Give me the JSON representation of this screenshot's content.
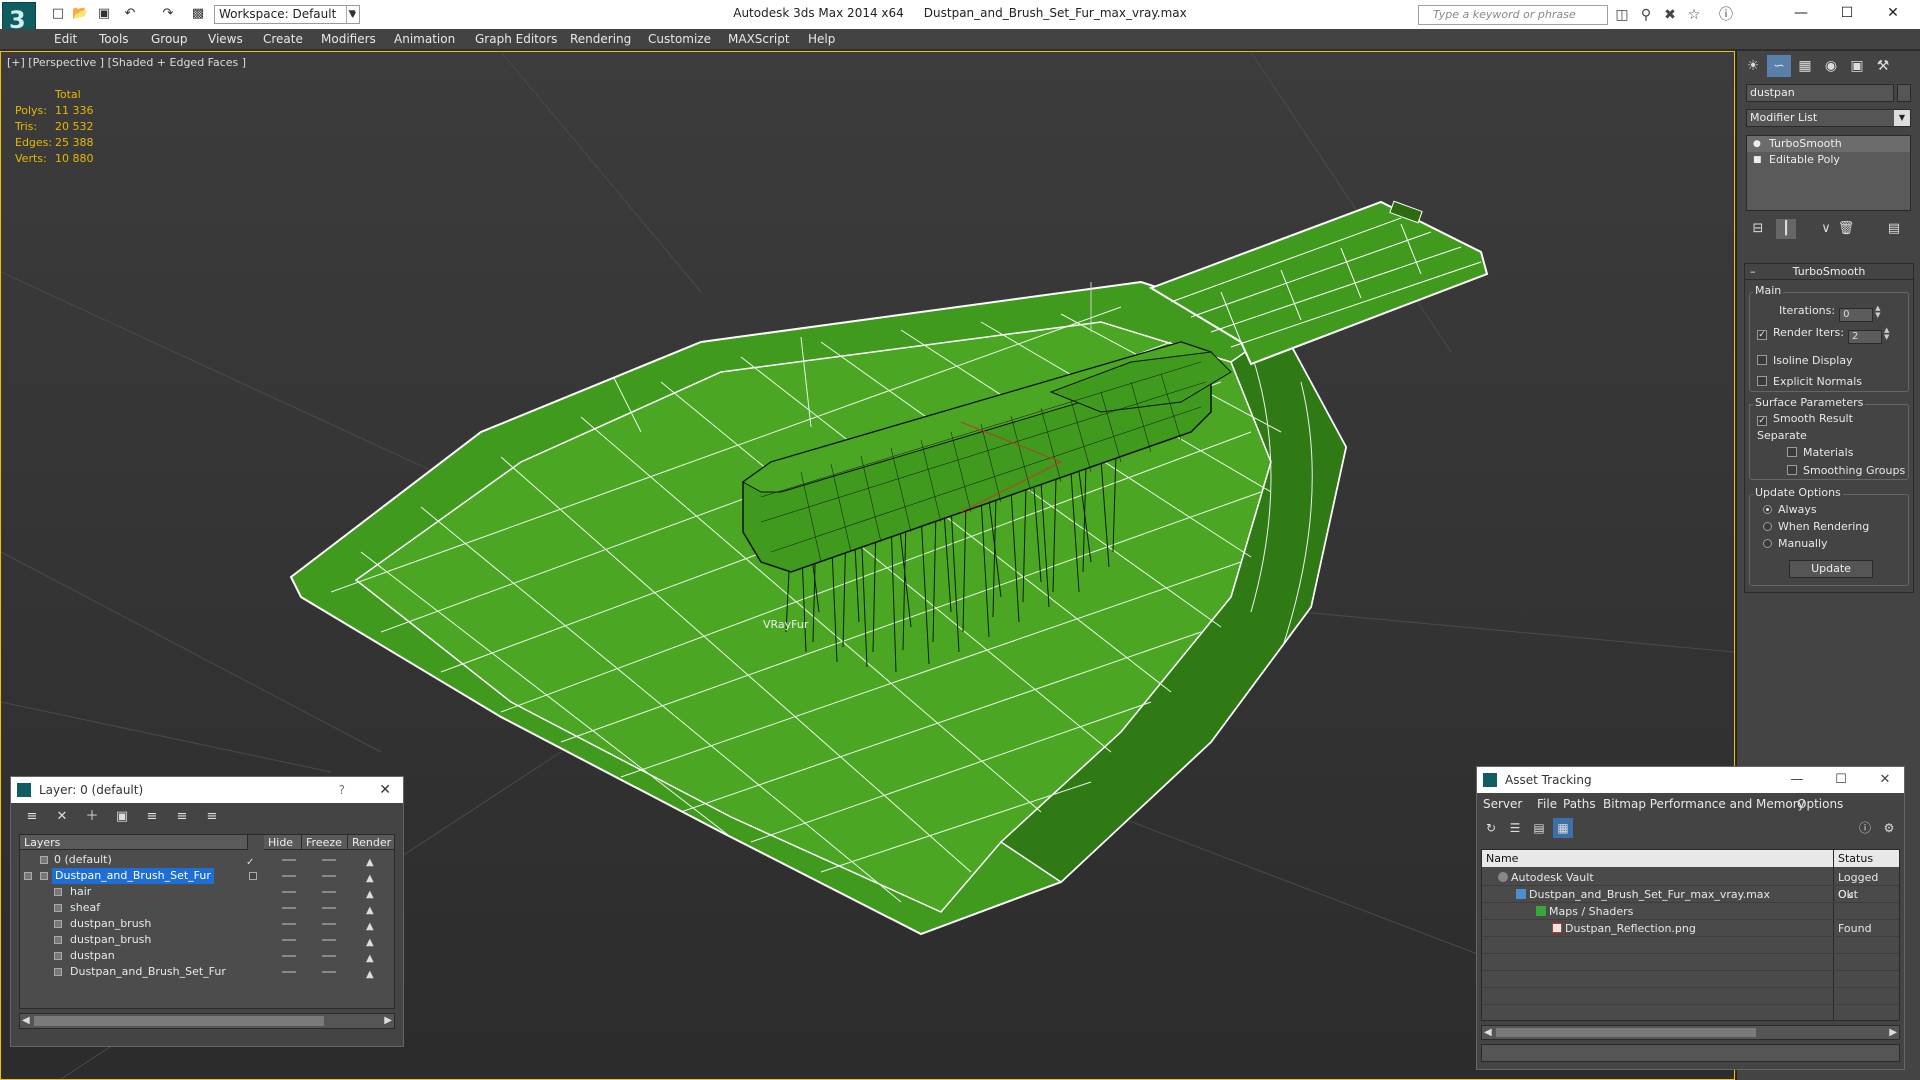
{
  "titlebar": {
    "app_title": "Autodesk 3ds Max 2014 x64",
    "file_title": "Dustpan_and_Brush_Set_Fur_max_vray.max",
    "workspace": "Workspace: Default",
    "search_placeholder": "Type a keyword or phrase"
  },
  "menu": [
    "Edit",
    "Tools",
    "Group",
    "Views",
    "Create",
    "Modifiers",
    "Animation",
    "Graph Editors",
    "Rendering",
    "Customize",
    "MAXScript",
    "Help"
  ],
  "viewport": {
    "label": "[+] [Perspective ] [Shaded + Edged Faces ]",
    "stats_header": "Total",
    "stats": [
      {
        "k": "Polys:",
        "v": "11 336"
      },
      {
        "k": "Tris:",
        "v": "20 532"
      },
      {
        "k": "Edges:",
        "v": "25 388"
      },
      {
        "k": "Verts:",
        "v": "10 880"
      }
    ],
    "object_label": "VRayFur",
    "colors": {
      "mesh": "#3f9a1e",
      "wire": "#ffffff",
      "background": "#3a3a3a",
      "selection_border": "#f0c000"
    }
  },
  "command_panel": {
    "object_name": "dustpan",
    "modifier_list": "Modifier List",
    "stack": [
      "TurboSmooth",
      "Editable Poly"
    ],
    "rollout_title": "TurboSmooth",
    "main_group": "Main",
    "iterations_label": "Iterations:",
    "iterations_value": "0",
    "render_iters_label": "Render Iters:",
    "render_iters_value": "2",
    "isoline_label": "Isoline Display",
    "explicit_normals_label": "Explicit Normals",
    "surface_group": "Surface Parameters",
    "smooth_result_label": "Smooth Result",
    "separate_label": "Separate",
    "materials_label": "Materials",
    "smoothing_groups_label": "Smoothing Groups",
    "update_group": "Update Options",
    "always_label": "Always",
    "when_rendering_label": "When Rendering",
    "manually_label": "Manually",
    "update_button": "Update"
  },
  "layer_dialog": {
    "title": "Layer: 0 (default)",
    "help": "?",
    "columns": [
      "Layers",
      "Hide",
      "Freeze",
      "Render"
    ],
    "rows": [
      {
        "name": "0 (default)",
        "indent": 0
      },
      {
        "name": "Dustpan_and_Brush_Set_Fur",
        "indent": 0
      },
      {
        "name": "hair",
        "indent": 1
      },
      {
        "name": "sheaf",
        "indent": 1
      },
      {
        "name": "dustpan_brush",
        "indent": 1
      },
      {
        "name": "dustpan_brush",
        "indent": 1
      },
      {
        "name": "dustpan",
        "indent": 1
      },
      {
        "name": "Dustpan_and_Brush_Set_Fur",
        "indent": 1
      }
    ]
  },
  "asset_tracking": {
    "title": "Asset Tracking",
    "menu": [
      "Server",
      "File",
      "Paths",
      "Bitmap Performance and Memory",
      "Options"
    ],
    "columns": [
      "Name",
      "Status"
    ],
    "rows": [
      {
        "name": "Autodesk Vault",
        "status": "Logged Out",
        "level": 0
      },
      {
        "name": "Dustpan_and_Brush_Set_Fur_max_vray.max",
        "status": "Ok",
        "level": 1
      },
      {
        "name": "Maps / Shaders",
        "status": "",
        "level": 2
      },
      {
        "name": "Dustpan_Reflection.png",
        "status": "Found",
        "level": 3
      }
    ]
  }
}
